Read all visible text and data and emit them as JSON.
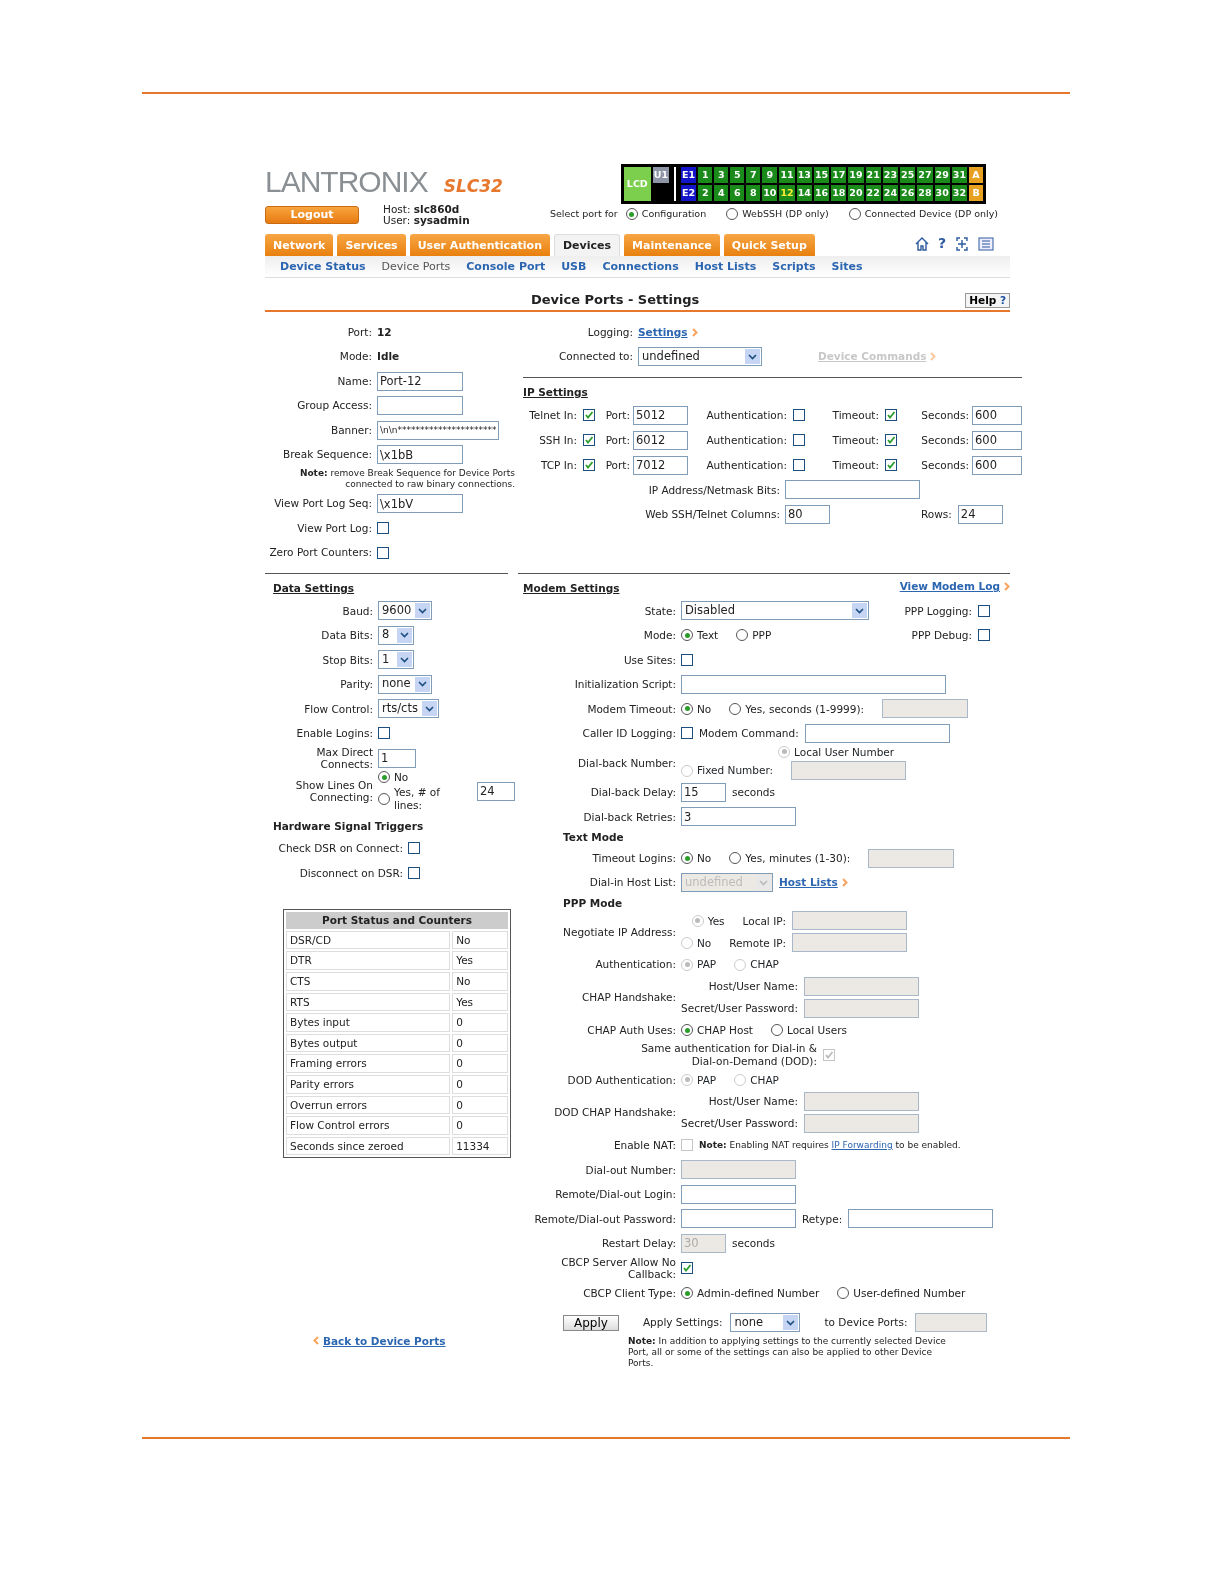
{
  "header": {
    "logo": "LANTRONIX",
    "model": "SLC32",
    "logout": "Logout",
    "host_label": "Host:",
    "host": "slc860d",
    "user_label": "User:",
    "user": "sysadmin"
  },
  "port_panel": {
    "lcd": "LCD",
    "unit": "U1",
    "expansion": [
      "E1",
      "E2"
    ],
    "ports_top": [
      {
        "label": "1",
        "selected": false
      },
      {
        "label": "3",
        "selected": false
      },
      {
        "label": "5",
        "selected": false
      },
      {
        "label": "7",
        "selected": false
      },
      {
        "label": "9",
        "selected": false
      },
      {
        "label": "11",
        "selected": false
      },
      {
        "label": "13",
        "selected": false
      },
      {
        "label": "15",
        "selected": false
      },
      {
        "label": "17",
        "selected": false
      },
      {
        "label": "19",
        "selected": false
      },
      {
        "label": "21",
        "selected": false
      },
      {
        "label": "23",
        "selected": false
      },
      {
        "label": "25",
        "selected": false
      },
      {
        "label": "27",
        "selected": false
      },
      {
        "label": "29",
        "selected": false
      },
      {
        "label": "31",
        "selected": false
      }
    ],
    "ports_bottom": [
      {
        "label": "2",
        "selected": false
      },
      {
        "label": "4",
        "selected": false
      },
      {
        "label": "6",
        "selected": false
      },
      {
        "label": "8",
        "selected": false
      },
      {
        "label": "10",
        "selected": false
      },
      {
        "label": "12",
        "selected": true
      },
      {
        "label": "14",
        "selected": false
      },
      {
        "label": "16",
        "selected": false
      },
      {
        "label": "18",
        "selected": false
      },
      {
        "label": "20",
        "selected": false
      },
      {
        "label": "22",
        "selected": false
      },
      {
        "label": "24",
        "selected": false
      },
      {
        "label": "26",
        "selected": false
      },
      {
        "label": "28",
        "selected": false
      },
      {
        "label": "30",
        "selected": false
      },
      {
        "label": "32",
        "selected": false
      }
    ],
    "banks": [
      "A",
      "B"
    ]
  },
  "port_select": {
    "label": "Select port for",
    "options": [
      {
        "label": "Configuration",
        "selected": true
      },
      {
        "label": "WebSSH (DP only)",
        "selected": false
      },
      {
        "label": "Connected Device (DP only)",
        "selected": false
      }
    ]
  },
  "toolbar": {
    "help": "?"
  },
  "tabs": [
    {
      "label": "Network",
      "selected": false
    },
    {
      "label": "Services",
      "selected": false
    },
    {
      "label": "User Authentication",
      "selected": false
    },
    {
      "label": "Devices",
      "selected": true
    },
    {
      "label": "Maintenance",
      "selected": false
    },
    {
      "label": "Quick Setup",
      "selected": false
    }
  ],
  "subnav": [
    {
      "label": "Device Status",
      "selected": false
    },
    {
      "label": "Device Ports",
      "selected": true
    },
    {
      "label": "Console Port",
      "selected": false
    },
    {
      "label": "USB",
      "selected": false
    },
    {
      "label": "Connections",
      "selected": false
    },
    {
      "label": "Host Lists",
      "selected": false
    },
    {
      "label": "Scripts",
      "selected": false
    },
    {
      "label": "Sites",
      "selected": false
    }
  ],
  "title": "Device Ports - Settings",
  "help_button": {
    "label": "Help",
    "mark": "?"
  },
  "port_info": {
    "rows": [
      {
        "label": "Port:",
        "controls": [
          {
            "kind": "value",
            "text": "12"
          }
        ]
      },
      {
        "label": "Mode:",
        "controls": [
          {
            "kind": "value",
            "text": "Idle"
          }
        ]
      },
      {
        "label": "Name:",
        "controls": [
          {
            "kind": "input",
            "value": "Port-12",
            "disabled": false
          }
        ]
      },
      {
        "label": "Group Access:",
        "controls": [
          {
            "kind": "input",
            "disabled": false
          }
        ]
      },
      {
        "label": "Banner:",
        "controls": [
          {
            "kind": "input",
            "value": "\\n\\n**********************",
            "disabled": false
          }
        ]
      },
      {
        "label": "Break Sequence:",
        "controls": [
          {
            "kind": "input",
            "value": "\\x1bB",
            "disabled": false
          }
        ]
      },
      {
        "controls": [
          {
            "kind": "note",
            "text": "**Note:** remove Break Sequence for Device Ports connected to raw binary connections."
          }
        ]
      },
      {
        "label": "View Port Log Seq:",
        "controls": [
          {
            "kind": "input",
            "value": "\\x1bV",
            "disabled": false
          }
        ]
      },
      {
        "label": "View Port Log:",
        "controls": [
          {
            "kind": "checkbox",
            "checked": false,
            "disabled": false
          }
        ]
      },
      {
        "label": "Zero Port Counters:",
        "controls": [
          {
            "kind": "checkbox",
            "checked": false,
            "disabled": false
          }
        ]
      }
    ]
  },
  "connection": {
    "rows": [
      {
        "label": "Logging:",
        "controls": [
          {
            "kind": "link",
            "text": "Settings",
            "disabled": false
          }
        ]
      },
      {
        "label": "Connected to:",
        "controls": [
          {
            "kind": "select",
            "value": "undefined",
            "disabled": false
          },
          {
            "kind": "link",
            "text": "Device Commands",
            "disabled": true
          }
        ]
      }
    ]
  },
  "ip_settings": {
    "heading": "IP Settings",
    "services": [
      {
        "label": "Telnet In:",
        "enabled": true,
        "port_label": "Port:",
        "port": "5012",
        "auth_label": "Authentication:",
        "auth": false,
        "timeout_label": "Timeout:",
        "timeout": true,
        "seconds_label": "Seconds:",
        "seconds": "600"
      },
      {
        "label": "SSH In:",
        "enabled": true,
        "port_label": "Port:",
        "port": "6012",
        "auth_label": "Authentication:",
        "auth": false,
        "timeout_label": "Timeout:",
        "timeout": true,
        "seconds_label": "Seconds:",
        "seconds": "600"
      },
      {
        "label": "TCP In:",
        "enabled": true,
        "port_label": "Port:",
        "port": "7012",
        "auth_label": "Authentication:",
        "auth": false,
        "timeout_label": "Timeout:",
        "timeout": true,
        "seconds_label": "Seconds:",
        "seconds": "600"
      }
    ],
    "rows": [
      {
        "label": "IP Address/Netmask Bits:",
        "controls": [
          {
            "kind": "input",
            "disabled": false
          }
        ]
      },
      {
        "label": "Web SSH/Telnet Columns:",
        "controls": [
          {
            "kind": "input",
            "value": "80",
            "disabled": false
          },
          {
            "kind": "text",
            "text": "Rows:"
          },
          {
            "kind": "input",
            "value": "24",
            "disabled": false
          }
        ]
      }
    ]
  },
  "data_settings": {
    "heading": "Data Settings",
    "rows": [
      {
        "label": "Baud:",
        "controls": [
          {
            "kind": "select",
            "value": "9600",
            "disabled": false
          }
        ]
      },
      {
        "label": "Data Bits:",
        "controls": [
          {
            "kind": "select",
            "value": "8",
            "disabled": false
          }
        ]
      },
      {
        "label": "Stop Bits:",
        "controls": [
          {
            "kind": "select",
            "value": "1",
            "disabled": false
          }
        ]
      },
      {
        "label": "Parity:",
        "controls": [
          {
            "kind": "select",
            "value": "none",
            "disabled": false
          }
        ]
      },
      {
        "label": "Flow Control:",
        "controls": [
          {
            "kind": "select",
            "value": "rts/cts",
            "disabled": false
          }
        ]
      },
      {
        "label": "Enable Logins:",
        "controls": [
          {
            "kind": "checkbox",
            "checked": false,
            "disabled": false
          }
        ]
      },
      {
        "label": "Max Direct Connects:",
        "controls": [
          {
            "kind": "input",
            "value": "1",
            "disabled": false
          }
        ]
      },
      {
        "label": "Show Lines On Connecting:",
        "controls": [
          {
            "kind": "stack",
            "lines": [
              [
                {
                  "kind": "radio",
                  "label": "No",
                  "selected": true,
                  "disabled": false
                }
              ],
              [
                {
                  "kind": "radio",
                  "label": "Yes, # of lines:",
                  "selected": false,
                  "disabled": false
                }
              ]
            ]
          },
          {
            "kind": "input",
            "value": "24",
            "disabled": false
          }
        ]
      }
    ]
  },
  "signal_triggers": {
    "heading": "Hardware Signal Triggers",
    "rows": [
      {
        "label": "Check DSR on Connect:",
        "controls": [
          {
            "kind": "checkbox",
            "checked": false,
            "disabled": false
          }
        ]
      },
      {
        "label": "Disconnect on DSR:",
        "controls": [
          {
            "kind": "checkbox",
            "checked": false,
            "disabled": false
          }
        ]
      }
    ]
  },
  "port_status": {
    "title": "Port Status and Counters",
    "rows": [
      {
        "name": "DSR/CD",
        "value": "No"
      },
      {
        "name": "DTR",
        "value": "Yes"
      },
      {
        "name": "CTS",
        "value": "No"
      },
      {
        "name": "RTS",
        "value": "Yes"
      },
      {
        "name": "Bytes input",
        "value": "0"
      },
      {
        "name": "Bytes output",
        "value": "0"
      },
      {
        "name": "Framing errors",
        "value": "0"
      },
      {
        "name": "Parity errors",
        "value": "0"
      },
      {
        "name": "Overrun errors",
        "value": "0"
      },
      {
        "name": "Flow Control errors",
        "value": "0"
      },
      {
        "name": "Seconds since zeroed",
        "value": "11334"
      }
    ]
  },
  "modem_settings": {
    "heading": "Modem Settings",
    "log_link": "View Modem Log",
    "rows": [
      {
        "kind": "field",
        "label": "State:",
        "controls": [
          {
            "kind": "select",
            "value": "Disabled",
            "disabled": false
          }
        ],
        "aside": {
          "label": "PPP Logging:",
          "checked": false
        }
      },
      {
        "kind": "field",
        "label": "Mode:",
        "controls": [
          {
            "kind": "radio",
            "label": "Text",
            "selected": true,
            "disabled": false
          },
          {
            "kind": "radio",
            "label": "PPP",
            "selected": false,
            "disabled": false
          }
        ],
        "aside": {
          "label": "PPP Debug:",
          "checked": false
        }
      },
      {
        "kind": "field",
        "label": "Use Sites:",
        "controls": [
          {
            "kind": "checkbox",
            "checked": false,
            "disabled": false
          }
        ]
      },
      {
        "kind": "field",
        "label": "Initialization Script:",
        "controls": [
          {
            "kind": "input",
            "disabled": false
          }
        ]
      },
      {
        "kind": "field",
        "label": "Modem Timeout:",
        "controls": [
          {
            "kind": "radio",
            "label": "No",
            "selected": true,
            "disabled": false
          },
          {
            "kind": "radio",
            "label": "Yes, seconds (1-9999):",
            "selected": false,
            "disabled": false
          },
          {
            "kind": "input",
            "disabled": true
          }
        ]
      },
      {
        "kind": "field",
        "label": "Caller ID Logging:",
        "controls": [
          {
            "kind": "checkbox",
            "checked": false,
            "disabled": false
          },
          {
            "kind": "text",
            "text": "Modem Command:"
          },
          {
            "kind": "input",
            "disabled": false
          }
        ]
      },
      {
        "kind": "field",
        "label": "Dial-back Number:",
        "controls": [
          {
            "kind": "stack",
            "lines": [
              [
                {
                  "kind": "radio",
                  "label": "Local User Number",
                  "selected": true,
                  "disabled": true
                }
              ],
              [
                {
                  "kind": "radio",
                  "label": "Fixed Number:",
                  "selected": false,
                  "disabled": true
                },
                {
                  "kind": "input",
                  "disabled": true
                }
              ]
            ]
          }
        ]
      },
      {
        "kind": "field",
        "label": "Dial-back Delay:",
        "controls": [
          {
            "kind": "input",
            "value": "15",
            "disabled": false
          },
          {
            "kind": "text",
            "text": "seconds"
          }
        ]
      },
      {
        "kind": "field",
        "label": "Dial-back Retries:",
        "controls": [
          {
            "kind": "input",
            "value": "3",
            "disabled": false
          }
        ]
      },
      {
        "kind": "subheading",
        "label": "Text Mode"
      },
      {
        "kind": "field",
        "label": "Timeout Logins:",
        "controls": [
          {
            "kind": "radio",
            "label": "No",
            "selected": true,
            "disabled": false
          },
          {
            "kind": "radio",
            "label": "Yes, minutes (1-30):",
            "selected": false,
            "disabled": false
          },
          {
            "kind": "input",
            "disabled": true
          }
        ]
      },
      {
        "kind": "field",
        "label": "Dial-in Host List:",
        "controls": [
          {
            "kind": "select",
            "value": "undefined",
            "disabled": true
          },
          {
            "kind": "link",
            "text": "Host Lists",
            "disabled": false
          }
        ]
      },
      {
        "kind": "subheading",
        "label": "PPP Mode"
      },
      {
        "kind": "field",
        "label": "Negotiate IP Address:",
        "controls": [
          {
            "kind": "stack",
            "lines": [
              [
                {
                  "kind": "radio",
                  "label": "Yes",
                  "selected": true,
                  "disabled": true
                },
                {
                  "kind": "text",
                  "text": "Local IP:"
                },
                {
                  "kind": "input",
                  "disabled": true
                }
              ],
              [
                {
                  "kind": "radio",
                  "label": "No",
                  "selected": false,
                  "disabled": true
                },
                {
                  "kind": "text",
                  "text": "Remote IP:"
                },
                {
                  "kind": "input",
                  "disabled": true
                }
              ]
            ]
          }
        ]
      },
      {
        "kind": "field",
        "label": "Authentication:",
        "controls": [
          {
            "kind": "radio",
            "label": "PAP",
            "selected": true,
            "disabled": true
          },
          {
            "kind": "radio",
            "label": "CHAP",
            "selected": false,
            "disabled": true
          }
        ]
      },
      {
        "kind": "field",
        "label": "CHAP Handshake:",
        "controls": [
          {
            "kind": "stack",
            "lines": [
              [
                {
                  "kind": "text",
                  "text": "Host/User Name:"
                },
                {
                  "kind": "input",
                  "disabled": true
                }
              ],
              [
                {
                  "kind": "text",
                  "text": "Secret/User Password:"
                },
                {
                  "kind": "input",
                  "disabled": true
                }
              ]
            ]
          }
        ]
      },
      {
        "kind": "field",
        "label": "CHAP Auth Uses:",
        "controls": [
          {
            "kind": "radio",
            "label": "CHAP Host",
            "selected": true,
            "disabled": false
          },
          {
            "kind": "radio",
            "label": "Local Users",
            "selected": false,
            "disabled": false
          }
        ]
      },
      {
        "kind": "caption",
        "label": "Same authentication for Dial-in & Dial-on-Demand (DOD):",
        "controls": [
          {
            "kind": "checkbox",
            "checked": true,
            "disabled": true
          }
        ]
      },
      {
        "kind": "field",
        "label": "DOD Authentication:",
        "controls": [
          {
            "kind": "radio",
            "label": "PAP",
            "selected": true,
            "disabled": true
          },
          {
            "kind": "radio",
            "label": "CHAP",
            "selected": false,
            "disabled": true
          }
        ]
      },
      {
        "kind": "field",
        "label": "DOD CHAP Handshake:",
        "controls": [
          {
            "kind": "stack",
            "lines": [
              [
                {
                  "kind": "text",
                  "text": "Host/User Name:"
                },
                {
                  "kind": "input",
                  "disabled": true
                }
              ],
              [
                {
                  "kind": "text",
                  "text": "Secret/User Password:"
                },
                {
                  "kind": "input",
                  "disabled": true
                }
              ]
            ]
          }
        ]
      },
      {
        "kind": "field",
        "label": "Enable NAT:",
        "controls": [
          {
            "kind": "checkbox",
            "checked": false,
            "disabled": true
          },
          {
            "kind": "note",
            "text": "**Note:** Enabling NAT requires ",
            "link": "IP Forwarding",
            "after": " to be enabled."
          }
        ]
      },
      {
        "kind": "field",
        "label": "Dial-out Number:",
        "controls": [
          {
            "kind": "input",
            "disabled": true
          }
        ]
      },
      {
        "kind": "field",
        "label": "Remote/Dial-out Login:",
        "controls": [
          {
            "kind": "input",
            "disabled": false
          }
        ]
      },
      {
        "kind": "field",
        "label": "Remote/Dial-out Password:",
        "controls": [
          {
            "kind": "input",
            "disabled": false
          },
          {
            "kind": "text",
            "text": "Retype:"
          },
          {
            "kind": "input",
            "disabled": false
          }
        ]
      },
      {
        "kind": "field",
        "label": "Restart Delay:",
        "controls": [
          {
            "kind": "input",
            "value": "30",
            "disabled": true
          },
          {
            "kind": "text",
            "text": "seconds"
          }
        ]
      },
      {
        "kind": "field",
        "label": "CBCP Server Allow No Callback:",
        "controls": [
          {
            "kind": "checkbox",
            "checked": true,
            "disabled": false
          }
        ]
      },
      {
        "kind": "field",
        "label": "CBCP Client Type:",
        "controls": [
          {
            "kind": "radio",
            "label": "Admin-defined Number",
            "selected": true,
            "disabled": false
          },
          {
            "kind": "radio",
            "label": "User-defined Number",
            "selected": false,
            "disabled": false
          }
        ]
      }
    ]
  },
  "footer": {
    "back_link": "Back to Device Ports",
    "apply": "Apply",
    "apply_label": "Apply Settings:",
    "apply_value": "none",
    "ports_label": "to Device Ports:",
    "note": "**Note:** In addition to applying settings to the currently selected Device Port, all or some of the settings can also be applied to other Device Ports."
  }
}
